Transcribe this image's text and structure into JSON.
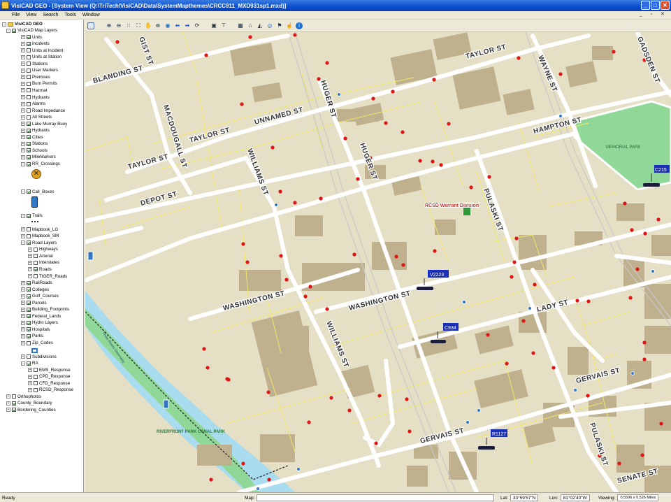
{
  "window": {
    "title": "VisiCAD GEO - [System View (Q:\\TriTech\\VisiCAD\\Data\\SystemMapthemes\\CRCC911_MXD931sp1.mxd)]",
    "min": "_",
    "max": "□",
    "close": "✕"
  },
  "menu": [
    "File",
    "View",
    "Search",
    "Tools",
    "Window"
  ],
  "mdi_controls": "_ ▫ ✕",
  "tree": {
    "root": "VisiCAD GEO",
    "items": [
      {
        "label": "VisiCAD Map Layers",
        "checked": true,
        "level": 1,
        "exp": "-"
      },
      {
        "label": "Units",
        "checked": true,
        "level": 2,
        "exp": "+"
      },
      {
        "label": "Incidents",
        "checked": true,
        "level": 2,
        "exp": "+"
      },
      {
        "label": "Units at Incident",
        "checked": false,
        "level": 2,
        "exp": "+"
      },
      {
        "label": "Units at Station",
        "checked": false,
        "level": 2,
        "exp": "+"
      },
      {
        "label": "Stations",
        "checked": false,
        "level": 2,
        "exp": "+"
      },
      {
        "label": "User Markers",
        "checked": false,
        "level": 2,
        "exp": "+"
      },
      {
        "label": "Premises",
        "checked": false,
        "level": 2,
        "exp": "+"
      },
      {
        "label": "Burn Permits",
        "checked": false,
        "level": 2,
        "exp": "+"
      },
      {
        "label": "Hazmat",
        "checked": false,
        "level": 2,
        "exp": "+"
      },
      {
        "label": "Hydrants",
        "checked": false,
        "level": 2,
        "exp": "+"
      },
      {
        "label": "Alarms",
        "checked": false,
        "level": 2,
        "exp": "+"
      },
      {
        "label": "Road Impedance",
        "checked": false,
        "level": 2,
        "exp": "+"
      },
      {
        "label": "All Streets",
        "checked": false,
        "level": 2,
        "exp": "+"
      },
      {
        "label": "Lake Murray Buoy",
        "checked": true,
        "level": 2,
        "exp": "+"
      },
      {
        "label": "Hydrants",
        "checked": true,
        "level": 2,
        "exp": "+"
      },
      {
        "label": "Cities",
        "checked": true,
        "level": 2,
        "exp": "+"
      },
      {
        "label": "Stations",
        "checked": true,
        "level": 2,
        "exp": "+"
      },
      {
        "label": "Schools",
        "checked": true,
        "level": 2,
        "exp": "+"
      },
      {
        "label": "MileMarkers",
        "checked": true,
        "level": 2,
        "exp": "+"
      },
      {
        "label": "RR_Crossings",
        "checked": true,
        "level": 2,
        "exp": "-"
      },
      {
        "label": "Call_Boxes",
        "checked": true,
        "level": 2,
        "exp": "-"
      },
      {
        "label": "Trails",
        "checked": true,
        "level": 2,
        "exp": "-"
      },
      {
        "label": "Mapbook_LG",
        "checked": false,
        "level": 2,
        "exp": "+"
      },
      {
        "label": "Mapbook_SM",
        "checked": false,
        "level": 2,
        "exp": "+"
      },
      {
        "label": "Road Layers",
        "checked": true,
        "level": 2,
        "exp": "-"
      },
      {
        "label": "Highways",
        "checked": false,
        "level": 3,
        "exp": "+"
      },
      {
        "label": "Arterial",
        "checked": false,
        "level": 3,
        "exp": "+"
      },
      {
        "label": "Interstates",
        "checked": false,
        "level": 3,
        "exp": "+"
      },
      {
        "label": "Roads",
        "checked": true,
        "level": 3,
        "exp": "+"
      },
      {
        "label": "TIGER_Roads",
        "checked": false,
        "level": 3,
        "exp": "+"
      },
      {
        "label": "RailRoads",
        "checked": true,
        "level": 2,
        "exp": "+"
      },
      {
        "label": "Colleges",
        "checked": true,
        "level": 2,
        "exp": "+"
      },
      {
        "label": "Golf_Courses",
        "checked": true,
        "level": 2,
        "exp": "+"
      },
      {
        "label": "Parcels",
        "checked": true,
        "level": 2,
        "exp": "+"
      },
      {
        "label": "Building_Footprints",
        "checked": true,
        "level": 2,
        "exp": "+"
      },
      {
        "label": "Federal_Lands",
        "checked": true,
        "level": 2,
        "exp": "+"
      },
      {
        "label": "Hydro Layers",
        "checked": true,
        "level": 2,
        "exp": "+"
      },
      {
        "label": "Hospitals",
        "checked": true,
        "level": 2,
        "exp": "+"
      },
      {
        "label": "Parks",
        "checked": true,
        "level": 2,
        "exp": "+"
      },
      {
        "label": "Zip_Codes",
        "checked": false,
        "level": 2,
        "exp": "+"
      },
      {
        "label": "Subdivisions",
        "checked": false,
        "level": 2,
        "exp": "+"
      },
      {
        "label": "RA",
        "checked": true,
        "level": 2,
        "exp": "-"
      },
      {
        "label": "EMS_Response",
        "checked": false,
        "level": 3,
        "exp": "+"
      },
      {
        "label": "CPD_Response",
        "checked": false,
        "level": 3,
        "exp": "+"
      },
      {
        "label": "CFD_Response",
        "checked": false,
        "level": 3,
        "exp": "+"
      },
      {
        "label": "RCSD_Response",
        "checked": false,
        "level": 3,
        "exp": "+"
      },
      {
        "label": "Orthophotos",
        "checked": false,
        "level": 1,
        "exp": "+"
      },
      {
        "label": "County_Boundary",
        "checked": true,
        "level": 1,
        "exp": "+"
      },
      {
        "label": "Bordering_Counties",
        "checked": true,
        "level": 1,
        "exp": "+"
      }
    ]
  },
  "map": {
    "streets": {
      "blanding": "BLANDING ST",
      "gist": "GIST ST",
      "taylor_ne": "TAYLOR ST",
      "wayne": "WAYNE ST",
      "gadsden": "GADSDEN ST",
      "unnamed": "UNNAMED ST",
      "taylor_mid": "TAYLOR ST",
      "taylor_w": "TAYLOR ST",
      "macdougall": "MACDOUGALL ST",
      "huger_n": "HUGER ST",
      "huger_mid": "HUGER ST",
      "hampton": "HAMPTON ST",
      "williams_n": "WILLIAMS ST",
      "depot": "DEPOT ST",
      "pulaski_n": "PULASKI ST",
      "washington_w": "WASHINGTON ST",
      "washington_e": "WASHINGTON ST",
      "lady": "LADY ST",
      "williams_s": "WILLIAMS ST",
      "gervais_e": "GERVAIS ST",
      "gervais_w": "GERVAIS ST",
      "pulaski_s": "PULASKI ST",
      "senate": "SENATE ST"
    },
    "places": {
      "memorial_park": "MEMORIAL PARK",
      "rcsd": "RCSD Warrant Division",
      "riverfront": "RIVERFRONT PARK CANAL PARK",
      "greenway": "Three Rivers Greenway"
    },
    "units": {
      "v2223": "V2223",
      "c934": "C934",
      "r1127": "R1127",
      "c215": "C215"
    },
    "colors": {
      "land": "#e4dfc5",
      "building": "#bfb18e",
      "road": "#ffffff",
      "parcel": "#f2e76a",
      "water": "#a9dcef",
      "park": "#8fd898",
      "incident": "#e01414",
      "unit_label": "#1a2fb8"
    }
  },
  "status": {
    "ready": "Ready",
    "map_label": "Map:",
    "lat_label": "Lat:",
    "lat": "33°59'57\"N",
    "lon_label": "Lon:",
    "lon": "81°02'40\"W",
    "viewing_label": "Viewing:",
    "viewing": "0.5596 x 0.526 Miles"
  }
}
